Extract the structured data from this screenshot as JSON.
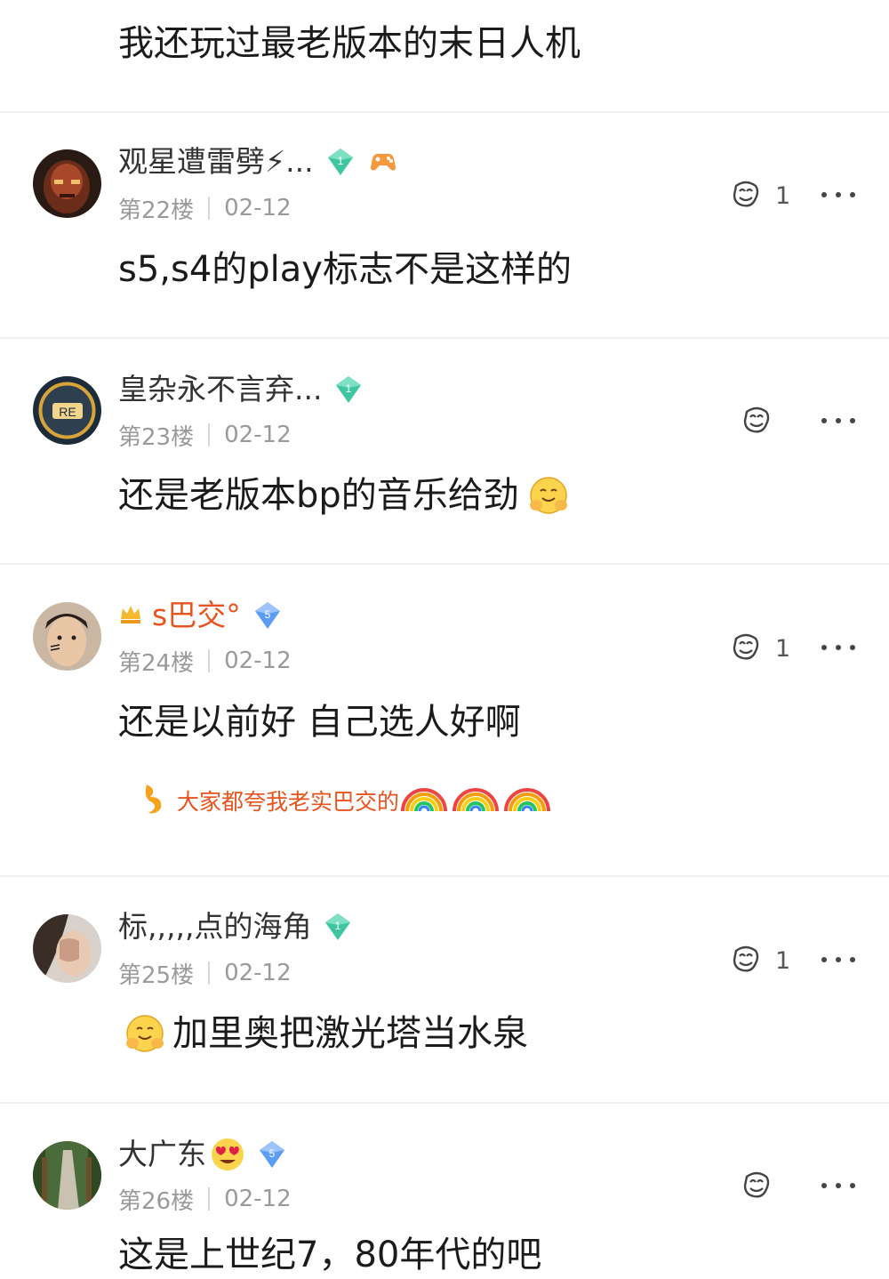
{
  "top_comment": {
    "content": "我还玩过最老版本的末日人机"
  },
  "comments": [
    {
      "username": "观星遭雷劈⚡...",
      "floor": "第22楼",
      "date": "02-12",
      "content": "s5,s4的play标志不是这样的",
      "likes": "1",
      "badge_level": "1",
      "badge_color": "#3ec6a0"
    },
    {
      "username": "皇杂永不言弃...",
      "floor": "第23楼",
      "date": "02-12",
      "content": "还是老版本bp的音乐给劲",
      "likes": "",
      "badge_level": "1",
      "badge_color": "#3ec6a0"
    },
    {
      "username": "s巴交°",
      "floor": "第24楼",
      "date": "02-12",
      "content": "还是以前好 自己选人好啊",
      "likes": "1",
      "badge_level": "5",
      "badge_color": "#5b9cf4",
      "signature": "大家都夸我老实巴交的"
    },
    {
      "username": "标,,,,,点的海角",
      "floor": "第25楼",
      "date": "02-12",
      "content": "加里奥把激光塔当水泉",
      "likes": "1",
      "badge_level": "1",
      "badge_color": "#3ec6a0"
    },
    {
      "username": "大广东",
      "floor": "第26楼",
      "date": "02-12",
      "content": "这是上世纪7，80年代的吧",
      "likes": "",
      "badge_level": "5",
      "badge_color": "#5b9cf4"
    }
  ],
  "colors": {
    "vip_name": "#e8541e",
    "meta_text": "#9a9a9a",
    "divider": "#eeeeee"
  },
  "icons": {
    "like": "thumbs-up-icon",
    "more": "more-dots-icon",
    "crown": "crown-icon",
    "signature": "signature-flame-icon"
  }
}
